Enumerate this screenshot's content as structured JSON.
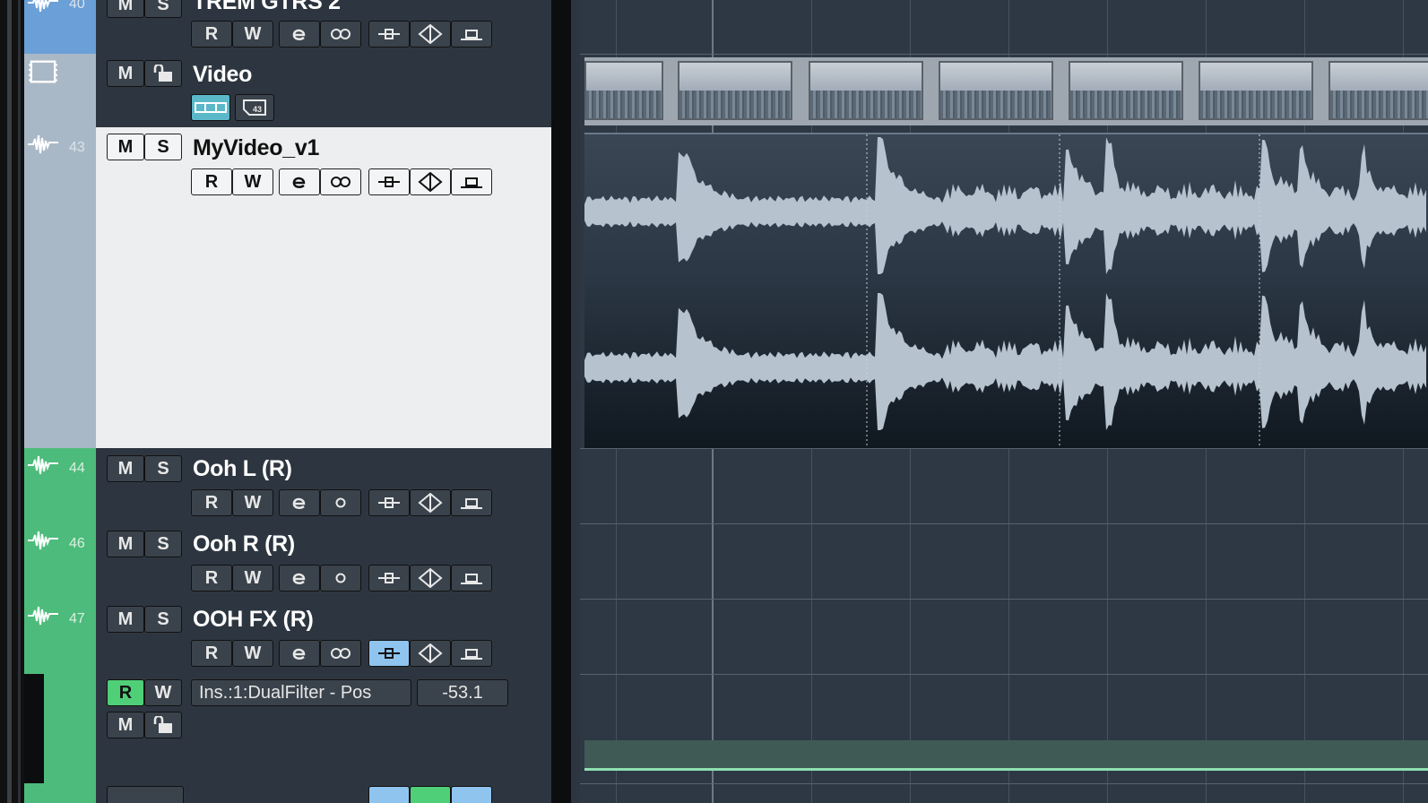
{
  "tracks": [
    {
      "id": "trem",
      "name": "TREM GTRS 2",
      "number": "40",
      "color": "#6a9fd8",
      "selected": false,
      "buttons": {
        "mute": "M",
        "solo": "S",
        "read": "R",
        "write": "W"
      }
    },
    {
      "id": "video",
      "name": "Video",
      "number": "",
      "color": "#a9b8c6",
      "selected": false,
      "buttons": {
        "mute": "M"
      }
    },
    {
      "id": "myvideo",
      "name": "MyVideo_v1",
      "number": "43",
      "color": "#a9b8c6",
      "selected": true,
      "buttons": {
        "mute": "M",
        "solo": "S",
        "read": "R",
        "write": "W"
      }
    },
    {
      "id": "oohl",
      "name": "Ooh L (R)",
      "number": "44",
      "color": "#4dbb7b",
      "selected": false,
      "buttons": {
        "mute": "M",
        "solo": "S",
        "read": "R",
        "write": "W"
      }
    },
    {
      "id": "oohr",
      "name": "Ooh R (R)",
      "number": "46",
      "color": "#4dbb7b",
      "selected": false,
      "buttons": {
        "mute": "M",
        "solo": "S",
        "read": "R",
        "write": "W"
      }
    },
    {
      "id": "oohfx",
      "name": "OOH FX (R)",
      "number": "47",
      "color": "#4dbb7b",
      "selected": false,
      "buttons": {
        "mute": "M",
        "solo": "S",
        "read": "R",
        "write": "W"
      }
    }
  ],
  "automation": {
    "parameter": "Ins.:1:DualFilter - Pos",
    "value": "-53.1",
    "read": "R",
    "write": "W",
    "mute": "M"
  },
  "colors": {
    "green": "#4dbb7b",
    "blue": "#6a9fd8",
    "video": "#a9b8c6",
    "selected_bg": "#eceeef"
  }
}
